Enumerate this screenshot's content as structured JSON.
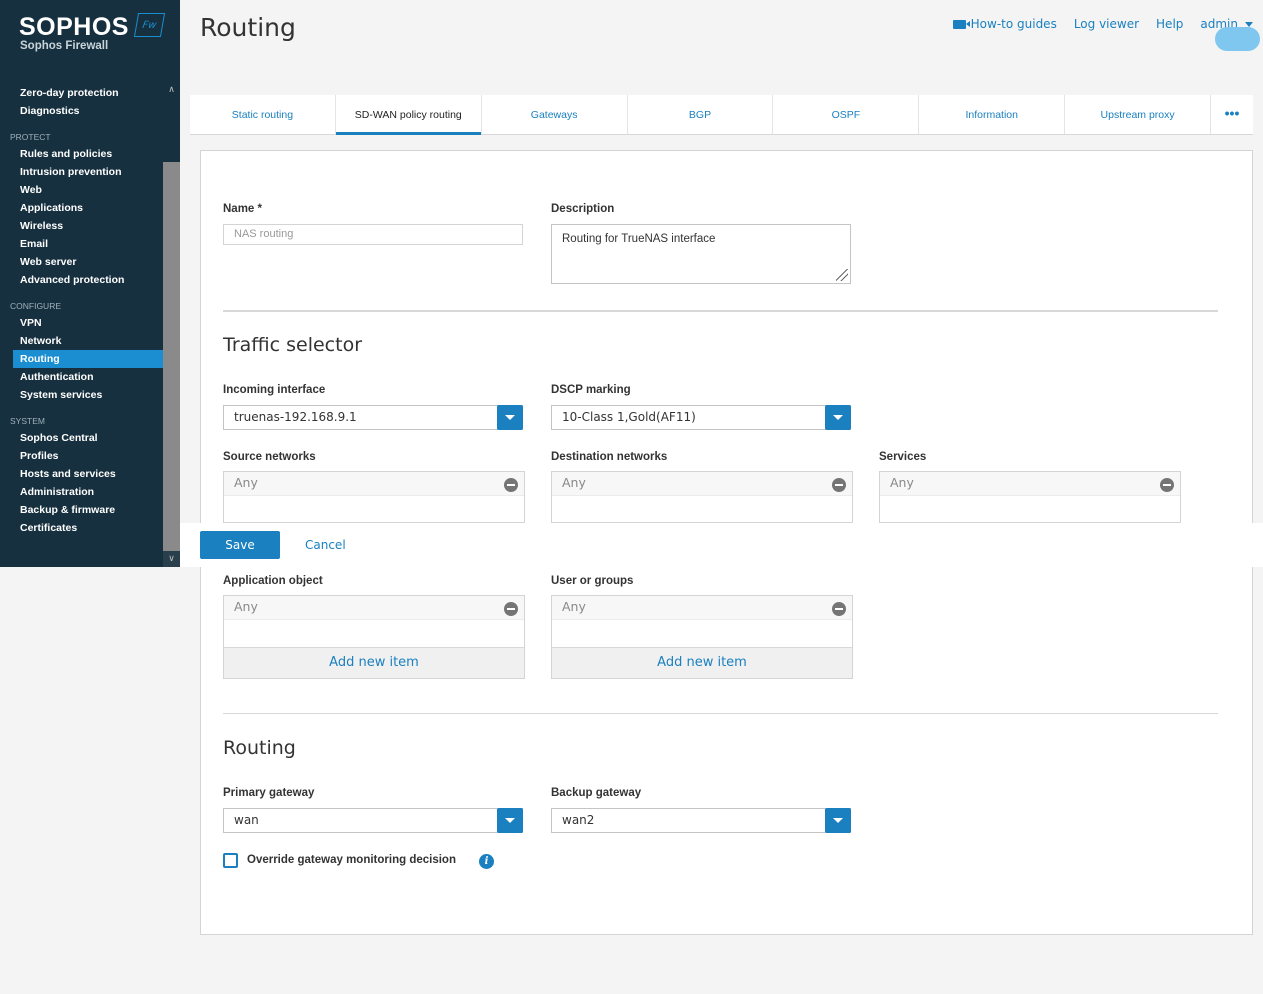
{
  "brand": {
    "name": "SOPHOS",
    "badge": "Fw",
    "product": "Sophos Firewall"
  },
  "nav": {
    "top_items": [
      "Zero-day protection",
      "Diagnostics"
    ],
    "sections": [
      {
        "title": "PROTECT",
        "items": [
          "Rules and policies",
          "Intrusion prevention",
          "Web",
          "Applications",
          "Wireless",
          "Email",
          "Web server",
          "Advanced protection"
        ]
      },
      {
        "title": "CONFIGURE",
        "items": [
          "VPN",
          "Network",
          "Routing",
          "Authentication",
          "System services"
        ]
      },
      {
        "title": "SYSTEM",
        "items": [
          "Sophos Central",
          "Profiles",
          "Hosts and services",
          "Administration",
          "Backup & firmware",
          "Certificates"
        ]
      }
    ],
    "active": "Routing"
  },
  "header": {
    "title": "Routing",
    "links": {
      "howto": "How-to guides",
      "logviewer": "Log viewer",
      "help": "Help",
      "admin": "admin"
    }
  },
  "tabs": [
    "Static routing",
    "SD-WAN policy routing",
    "Gateways",
    "BGP",
    "OSPF",
    "Information",
    "Upstream proxy"
  ],
  "tabs_more": "•••",
  "active_tab": "SD-WAN policy routing",
  "form": {
    "name_label": "Name *",
    "name_placeholder": "NAS routing",
    "description_label": "Description",
    "description_value": "Routing for TrueNAS interface",
    "traffic_title": "Traffic selector",
    "incoming_label": "Incoming interface",
    "incoming_value": "truenas-192.168.9.1",
    "dscp_label": "DSCP marking",
    "dscp_value": "10-Class 1,Gold(AF11)",
    "source_label": "Source networks",
    "source_value": "Any",
    "dest_label": "Destination networks",
    "dest_value": "Any",
    "services_label": "Services",
    "services_value": "Any",
    "app_label": "Application object",
    "app_value": "Any",
    "users_label": "User or groups",
    "users_value": "Any",
    "add_new": "Add new item",
    "routing_title": "Routing",
    "primary_label": "Primary gateway",
    "primary_value": "wan",
    "backup_label": "Backup gateway",
    "backup_value": "wan2",
    "override_label": "Override gateway monitoring decision",
    "info_glyph": "i"
  },
  "actions": {
    "save": "Save",
    "cancel": "Cancel"
  },
  "colors": {
    "sidebar": "#17303f",
    "accent": "#1a80c0",
    "active_nav": "#1a8ed1"
  }
}
